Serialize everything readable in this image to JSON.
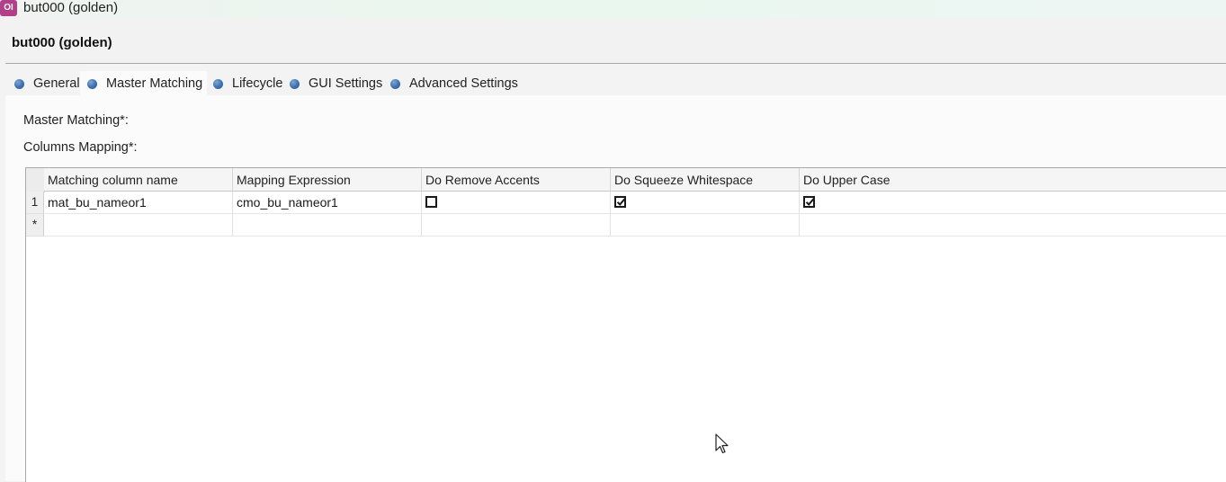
{
  "window": {
    "app_icon_text": "OI",
    "title": "but000 (golden)"
  },
  "editor": {
    "title": "but000 (golden)"
  },
  "tabs": [
    {
      "label": "General",
      "active": false
    },
    {
      "label": "Master Matching",
      "active": true
    },
    {
      "label": "Lifecycle",
      "active": false
    },
    {
      "label": "GUI Settings",
      "active": false
    },
    {
      "label": "Advanced Settings",
      "active": false
    }
  ],
  "form": {
    "master_matching_label": "Master Matching*:",
    "columns_mapping_label": "Columns Mapping*:"
  },
  "grid": {
    "columns": [
      "Matching column name",
      "Mapping Expression",
      "Do Remove Accents",
      "Do Squeeze Whitespace",
      "Do Upper Case"
    ],
    "rows": [
      {
        "row_header": "1",
        "matching_column_name": "mat_bu_nameor1",
        "mapping_expression": "cmo_bu_nameor1",
        "do_remove_accents": false,
        "do_squeeze_whitespace": true,
        "do_upper_case": true
      }
    ],
    "new_row_marker": "*"
  },
  "colors": {
    "tab_dot": "#3d6fae",
    "app_icon": "#b23f8a"
  }
}
